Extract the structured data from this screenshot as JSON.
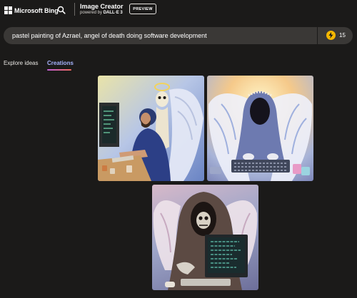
{
  "header": {
    "logo_text": "Microsoft Bing",
    "brand_title": "Image Creator",
    "brand_powered": "powered by",
    "brand_engine": "DALL·E 3",
    "preview_label": "PREVIEW",
    "search_icon": "search-icon"
  },
  "prompt": {
    "text": "pastel painting of Azrael, angel of death doing software development",
    "boost_count": "15",
    "boost_icon": "lightning-icon",
    "boost_color": "#f5b700"
  },
  "tabs": [
    {
      "label": "Explore ideas",
      "active": false
    },
    {
      "label": "Creations",
      "active": true
    }
  ],
  "colors": {
    "background": "#1b1a19",
    "active_tab": "#a7b4ff"
  }
}
